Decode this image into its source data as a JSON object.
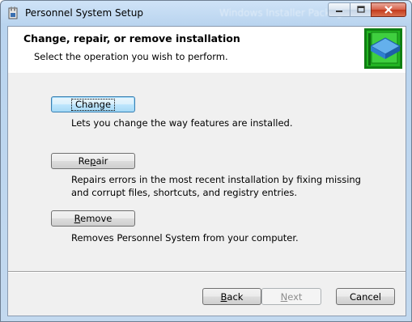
{
  "window": {
    "title": "Personnel System Setup",
    "background_title": "Windows Installer Package"
  },
  "banner": {
    "heading": "Change, repair, or remove installation",
    "subheading": "Select the operation you wish to perform."
  },
  "options": [
    {
      "label_pre": "",
      "label_accel": "C",
      "label_post": "hange",
      "description": "Lets you change the way features are installed."
    },
    {
      "label_pre": "Re",
      "label_accel": "p",
      "label_post": "air",
      "description": "Repairs errors in the most recent installation by fixing missing and corrupt files, shortcuts, and registry entries."
    },
    {
      "label_pre": "",
      "label_accel": "R",
      "label_post": "emove",
      "description": "Removes Personnel System from your computer."
    }
  ],
  "footer": {
    "back": {
      "pre": "",
      "accel": "B",
      "post": "ack"
    },
    "next": {
      "pre": "",
      "accel": "N",
      "post": "ext"
    },
    "cancel": "Cancel"
  },
  "colors": {
    "logo_green": "#1aa21a",
    "logo_blue": "#2f7fd0",
    "focus_blue": "#3c7fb1"
  }
}
